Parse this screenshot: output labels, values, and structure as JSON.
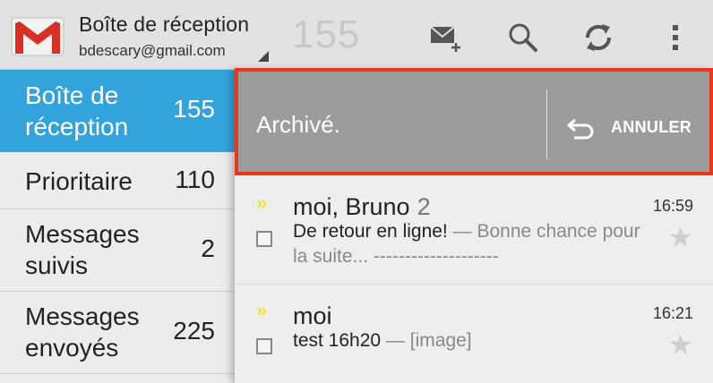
{
  "actionbar": {
    "title": "Boîte de réception",
    "account": "bdescary@gmail.com",
    "unread_count": "155",
    "icons": [
      "compose-icon",
      "search-icon",
      "refresh-icon",
      "overflow-menu-icon"
    ]
  },
  "sidebar": {
    "items": [
      {
        "label": "Boîte de réception",
        "count": "155",
        "active": true
      },
      {
        "label": "Prioritaire",
        "count": "110"
      },
      {
        "label": "Messages suivis",
        "count": "2"
      },
      {
        "label": "Messages envoyés",
        "count": "225"
      }
    ]
  },
  "undo": {
    "message": "Archivé.",
    "action": "ANNULER"
  },
  "messages": [
    {
      "sender": "moi, Bruno",
      "count": "2",
      "time": "16:59",
      "subject": "De retour en ligne!",
      "snippet": "Bonne chance pour la suite... --------------------"
    },
    {
      "sender": "moi",
      "count": "",
      "time": "16:21",
      "subject": "test 16h20",
      "snippet": "[image]"
    }
  ],
  "colors": {
    "accent": "#33a3dc",
    "undo_bar": "#9c9c9c",
    "highlight_border": "#e8381a",
    "importance_marker": "#f2e23a"
  }
}
